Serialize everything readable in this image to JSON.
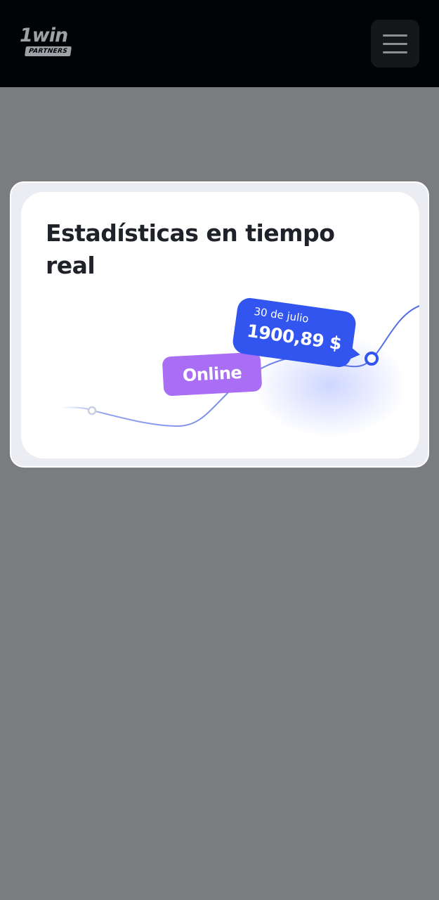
{
  "header": {
    "logo_word": "1win",
    "logo_partners": "PARTNERS"
  },
  "card": {
    "title": "Estadísticas en tiempo real",
    "badge_label": "Online",
    "tooltip": {
      "date": "30 de julio",
      "amount": "1900,89 $"
    },
    "colors": {
      "line": "#4f67e4",
      "badge": "#a96ef4",
      "tooltip": "#3255f0"
    }
  }
}
